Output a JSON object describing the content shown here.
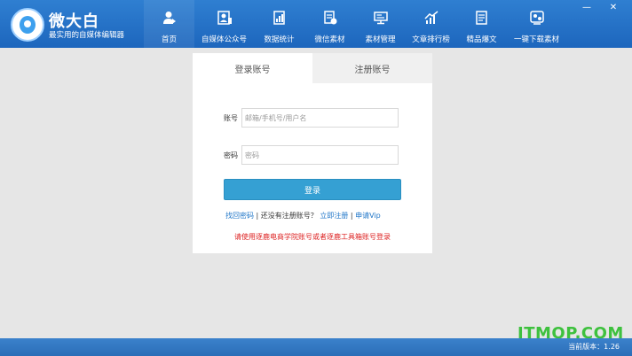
{
  "brand": {
    "title": "微大白",
    "subtitle": "最实用的自媒体编辑器"
  },
  "nav": [
    {
      "label": "首页",
      "icon": "person-home-icon"
    },
    {
      "label": "自媒体公众号",
      "icon": "media-account-icon"
    },
    {
      "label": "数据统计",
      "icon": "stats-icon"
    },
    {
      "label": "微信素材",
      "icon": "wechat-material-icon"
    },
    {
      "label": "素材管理",
      "icon": "material-manage-icon"
    },
    {
      "label": "文章排行榜",
      "icon": "chart-rank-icon"
    },
    {
      "label": "精品爆文",
      "icon": "hot-article-icon"
    },
    {
      "label": "一键下载素材",
      "icon": "download-material-icon"
    }
  ],
  "window_controls": {
    "minimize": "—",
    "close": "✕"
  },
  "login": {
    "tab_login": "登录账号",
    "tab_register": "注册账号",
    "account_label": "账号",
    "account_placeholder": "邮箱/手机号/用户名",
    "password_label": "密码",
    "password_placeholder": "密码",
    "submit": "登录",
    "forgot": "找回密码",
    "sep1": " | ",
    "no_account": "还没有注册账号？",
    "register_now": "立即注册",
    "sep2": " | ",
    "apply_vip": "申请Vip",
    "notice": "请使用逐鹿电商学院账号或者逐鹿工具箱账号登录"
  },
  "watermark": "ITMOP.COM",
  "version": "当前版本：1.26",
  "colors": {
    "topbar": "#1d66bd",
    "button": "#35a0d3",
    "notice": "#d22222",
    "link": "#1f76c8"
  }
}
